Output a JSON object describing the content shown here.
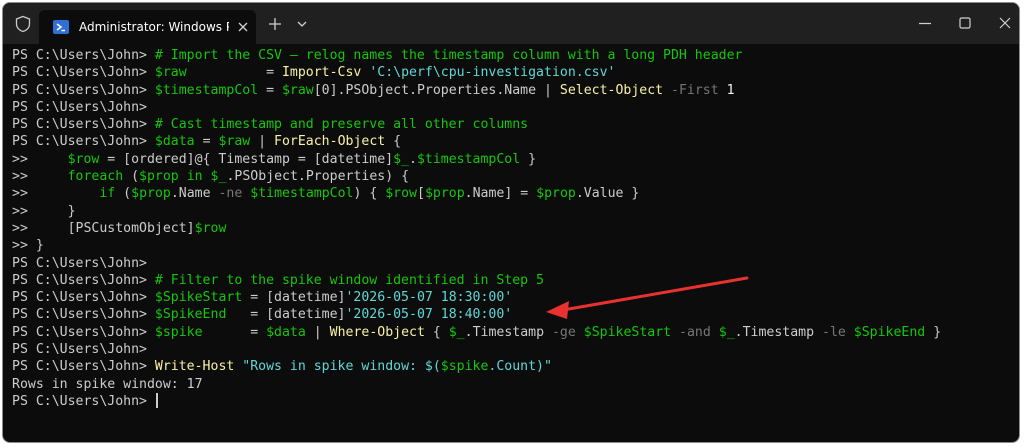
{
  "window": {
    "tab_title": "Administrator: Windows Powe",
    "colors": {
      "titlebar": "#202020",
      "background": "#0c0c0c",
      "arrow": "#e8322f"
    }
  },
  "titlebar_icons": [
    "shield-icon",
    "powershell-icon",
    "close-icon",
    "plus-icon",
    "chevron-down-icon",
    "minimize-icon",
    "maximize-icon",
    "close-icon"
  ],
  "console": {
    "lines": [
      [
        {
          "t": "PS C:\\Users\\John> ",
          "c": "white"
        },
        {
          "t": "# Import the CSV — relog names the timestamp column with a long PDH header",
          "c": "green"
        }
      ],
      [
        {
          "t": "PS C:\\Users\\John> ",
          "c": "white"
        },
        {
          "t": "$raw",
          "c": "green"
        },
        {
          "t": "          = ",
          "c": "white"
        },
        {
          "t": "Import-Csv",
          "c": "yellow"
        },
        {
          "t": " ",
          "c": "white"
        },
        {
          "t": "'C:\\perf\\cpu-investigation.csv'",
          "c": "cyan"
        }
      ],
      [
        {
          "t": "PS C:\\Users\\John> ",
          "c": "white"
        },
        {
          "t": "$timestampCol",
          "c": "green"
        },
        {
          "t": " = ",
          "c": "white"
        },
        {
          "t": "$raw",
          "c": "green"
        },
        {
          "t": "[0].PSObject.Properties.Name | ",
          "c": "white"
        },
        {
          "t": "Select-Object",
          "c": "yellow"
        },
        {
          "t": " -First ",
          "c": "gray"
        },
        {
          "t": "1",
          "c": "bwhite"
        }
      ],
      [
        {
          "t": "PS C:\\Users\\John> ",
          "c": "white"
        }
      ],
      [
        {
          "t": "PS C:\\Users\\John> ",
          "c": "white"
        },
        {
          "t": "# Cast timestamp and preserve all other columns",
          "c": "green"
        }
      ],
      [
        {
          "t": "PS C:\\Users\\John> ",
          "c": "white"
        },
        {
          "t": "$data",
          "c": "green"
        },
        {
          "t": " = ",
          "c": "white"
        },
        {
          "t": "$raw",
          "c": "green"
        },
        {
          "t": " | ",
          "c": "white"
        },
        {
          "t": "ForEach-Object",
          "c": "yellow"
        },
        {
          "t": " {",
          "c": "white"
        }
      ],
      [
        {
          "t": ">>     ",
          "c": "white"
        },
        {
          "t": "$row",
          "c": "green"
        },
        {
          "t": " = [ordered]@{ Timestamp = [datetime]",
          "c": "white"
        },
        {
          "t": "$_",
          "c": "green"
        },
        {
          "t": ".",
          "c": "white"
        },
        {
          "t": "$timestampCol",
          "c": "green"
        },
        {
          "t": " }",
          "c": "white"
        }
      ],
      [
        {
          "t": ">>     ",
          "c": "white"
        },
        {
          "t": "foreach",
          "c": "green"
        },
        {
          "t": " (",
          "c": "white"
        },
        {
          "t": "$prop",
          "c": "green"
        },
        {
          "t": " ",
          "c": "white"
        },
        {
          "t": "in",
          "c": "green"
        },
        {
          "t": " ",
          "c": "white"
        },
        {
          "t": "$_",
          "c": "green"
        },
        {
          "t": ".PSObject.Properties) {",
          "c": "white"
        }
      ],
      [
        {
          "t": ">>         ",
          "c": "white"
        },
        {
          "t": "if",
          "c": "green"
        },
        {
          "t": " (",
          "c": "white"
        },
        {
          "t": "$prop",
          "c": "green"
        },
        {
          "t": ".Name ",
          "c": "white"
        },
        {
          "t": "-ne",
          "c": "gray"
        },
        {
          "t": " ",
          "c": "white"
        },
        {
          "t": "$timestampCol",
          "c": "green"
        },
        {
          "t": ") { ",
          "c": "white"
        },
        {
          "t": "$row",
          "c": "green"
        },
        {
          "t": "[",
          "c": "white"
        },
        {
          "t": "$prop",
          "c": "green"
        },
        {
          "t": ".Name] = ",
          "c": "white"
        },
        {
          "t": "$prop",
          "c": "green"
        },
        {
          "t": ".Value }",
          "c": "white"
        }
      ],
      [
        {
          "t": ">>     }",
          "c": "white"
        }
      ],
      [
        {
          "t": ">>     [PSCustomObject]",
          "c": "white"
        },
        {
          "t": "$row",
          "c": "green"
        }
      ],
      [
        {
          "t": ">> }",
          "c": "white"
        }
      ],
      [
        {
          "t": "PS C:\\Users\\John> ",
          "c": "white"
        }
      ],
      [
        {
          "t": "PS C:\\Users\\John> ",
          "c": "white"
        },
        {
          "t": "# Filter to the spike window identified in Step 5",
          "c": "green"
        }
      ],
      [
        {
          "t": "PS C:\\Users\\John> ",
          "c": "white"
        },
        {
          "t": "$SpikeStart",
          "c": "green"
        },
        {
          "t": " = [datetime]",
          "c": "white"
        },
        {
          "t": "'2026-05-07 18:30:00'",
          "c": "cyan"
        }
      ],
      [
        {
          "t": "PS C:\\Users\\John> ",
          "c": "white"
        },
        {
          "t": "$SpikeEnd",
          "c": "green"
        },
        {
          "t": "   = [datetime]",
          "c": "white"
        },
        {
          "t": "'2026-05-07 18:40:00'",
          "c": "cyan"
        }
      ],
      [
        {
          "t": "PS C:\\Users\\John> ",
          "c": "white"
        },
        {
          "t": "$spike",
          "c": "green"
        },
        {
          "t": "      = ",
          "c": "white"
        },
        {
          "t": "$data",
          "c": "green"
        },
        {
          "t": " | ",
          "c": "white"
        },
        {
          "t": "Where-Object",
          "c": "yellow"
        },
        {
          "t": " { ",
          "c": "white"
        },
        {
          "t": "$_",
          "c": "green"
        },
        {
          "t": ".Timestamp ",
          "c": "white"
        },
        {
          "t": "-ge",
          "c": "gray"
        },
        {
          "t": " ",
          "c": "white"
        },
        {
          "t": "$SpikeStart",
          "c": "green"
        },
        {
          "t": " ",
          "c": "white"
        },
        {
          "t": "-and",
          "c": "gray"
        },
        {
          "t": " ",
          "c": "white"
        },
        {
          "t": "$_",
          "c": "green"
        },
        {
          "t": ".Timestamp ",
          "c": "white"
        },
        {
          "t": "-le",
          "c": "gray"
        },
        {
          "t": " ",
          "c": "white"
        },
        {
          "t": "$SpikeEnd",
          "c": "green"
        },
        {
          "t": " }",
          "c": "white"
        }
      ],
      [
        {
          "t": "PS C:\\Users\\John> ",
          "c": "white"
        }
      ],
      [
        {
          "t": "PS C:\\Users\\John> ",
          "c": "white"
        },
        {
          "t": "Write-Host",
          "c": "yellow"
        },
        {
          "t": " ",
          "c": "white"
        },
        {
          "t": "\"Rows in spike window: $(",
          "c": "cyan"
        },
        {
          "t": "$spike",
          "c": "green"
        },
        {
          "t": ".Count)\"",
          "c": "cyan"
        }
      ],
      [
        {
          "t": "Rows in spike window: 17",
          "c": "white"
        }
      ],
      [
        {
          "t": "PS C:\\Users\\John> ",
          "c": "white"
        }
      ]
    ]
  }
}
